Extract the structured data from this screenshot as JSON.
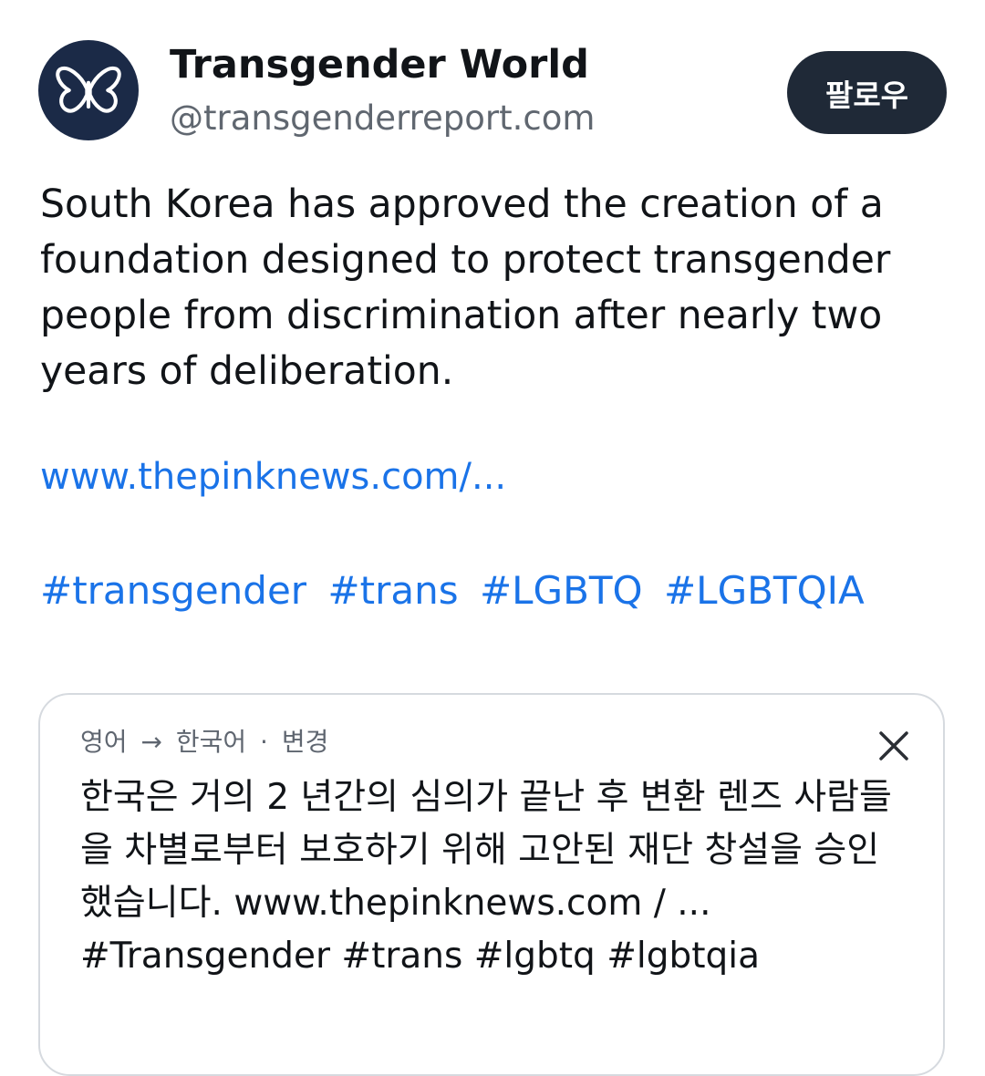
{
  "account": {
    "display_name": "Transgender World",
    "handle": "@transgenderreport.com",
    "avatar_icon": "butterfly-icon"
  },
  "follow_button": {
    "label": "팔로우"
  },
  "post": {
    "body": "South Korea has approved the creation of a foundation designed to protect transgender people from discrimination after nearly two years of deliberation.",
    "link": "www.thepinknews.com/...",
    "hashtags": [
      "#transgender",
      "#trans",
      "#LGBTQ",
      "#LGBTQIA"
    ]
  },
  "translation": {
    "source_lang": "영어",
    "arrow": "→",
    "target_lang": "한국어",
    "separator": "·",
    "change_label": "변경",
    "text": "한국은 거의 2 년간의 심의가 끝난 후 변환 렌즈 사람들을 차별로부터 보호하기 위해 고안된 재단 창설을 승인했습니다. www.thepinknews.com / ... #Transgender #trans #lgbtq #lgbtqia"
  },
  "colors": {
    "link": "#1a73e8",
    "follow_bg": "#1f2937",
    "avatar_bg": "#1b2a47"
  }
}
